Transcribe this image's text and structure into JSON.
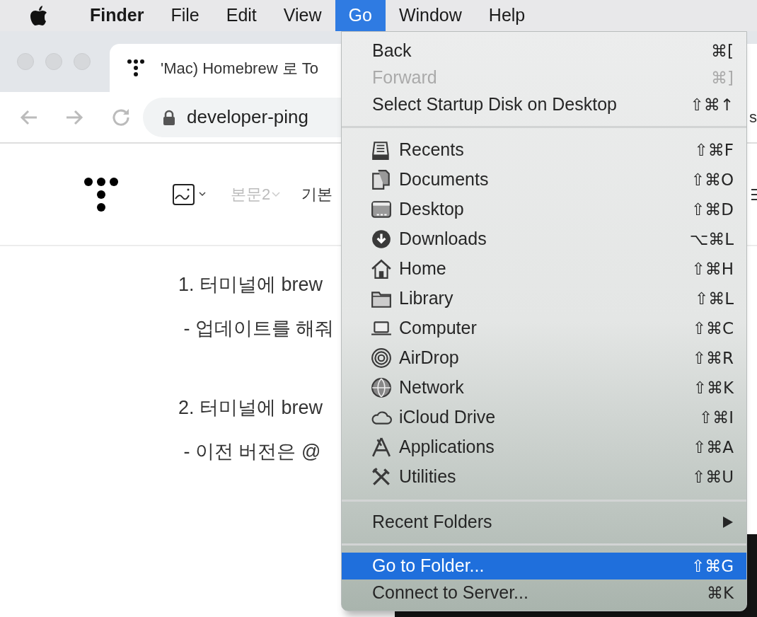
{
  "menu_bar": {
    "items": [
      {
        "label": "Finder",
        "kind": "app",
        "selected": false
      },
      {
        "label": "File",
        "kind": "menu",
        "selected": false
      },
      {
        "label": "Edit",
        "kind": "menu",
        "selected": false
      },
      {
        "label": "View",
        "kind": "menu",
        "selected": false
      },
      {
        "label": "Go",
        "kind": "menu",
        "selected": true
      },
      {
        "label": "Window",
        "kind": "menu",
        "selected": false
      },
      {
        "label": "Help",
        "kind": "menu",
        "selected": false
      }
    ]
  },
  "browser": {
    "tab_title": "'Mac) Homebrew 로 To",
    "address": "developer-ping",
    "address_tail": "s",
    "toolbar": {
      "style_label": "본문2",
      "font_label": "기본"
    },
    "content": [
      {
        "text": "1. 터미널에 brew",
        "kind": "step"
      },
      {
        "text": " - 업데이트를 해줘",
        "kind": "note"
      },
      {
        "text": "2. 터미널에 brew",
        "kind": "step"
      },
      {
        "text": " - 이전 버전은 @",
        "kind": "note"
      }
    ]
  },
  "go_menu": {
    "sections": [
      {
        "items": [
          {
            "label": "Back",
            "shortcut": "⌘[",
            "kind": "plain",
            "disabled": false,
            "selected": false
          },
          {
            "label": "Forward",
            "shortcut": "⌘]",
            "kind": "plain",
            "disabled": true,
            "selected": false
          },
          {
            "label": "Select Startup Disk on Desktop",
            "shortcut": "⇧⌘↑",
            "kind": "plain",
            "disabled": false,
            "selected": false
          }
        ]
      },
      {
        "items": [
          {
            "label": "Recents",
            "shortcut": "⇧⌘F",
            "kind": "place",
            "disabled": false,
            "selected": false
          },
          {
            "label": "Documents",
            "shortcut": "⇧⌘O",
            "kind": "place",
            "disabled": false,
            "selected": false
          },
          {
            "label": "Desktop",
            "shortcut": "⇧⌘D",
            "kind": "place",
            "disabled": false,
            "selected": false
          },
          {
            "label": "Downloads",
            "shortcut": "⌥⌘L",
            "kind": "place",
            "disabled": false,
            "selected": false
          },
          {
            "label": "Home",
            "shortcut": "⇧⌘H",
            "kind": "place",
            "disabled": false,
            "selected": false
          },
          {
            "label": "Library",
            "shortcut": "⇧⌘L",
            "kind": "place",
            "disabled": false,
            "selected": false
          },
          {
            "label": "Computer",
            "shortcut": "⇧⌘C",
            "kind": "place",
            "disabled": false,
            "selected": false
          },
          {
            "label": "AirDrop",
            "shortcut": "⇧⌘R",
            "kind": "place",
            "disabled": false,
            "selected": false
          },
          {
            "label": "Network",
            "shortcut": "⇧⌘K",
            "kind": "place",
            "disabled": false,
            "selected": false
          },
          {
            "label": "iCloud Drive",
            "shortcut": "⇧⌘I",
            "kind": "place",
            "disabled": false,
            "selected": false
          },
          {
            "label": "Applications",
            "shortcut": "⇧⌘A",
            "kind": "place",
            "disabled": false,
            "selected": false
          },
          {
            "label": "Utilities",
            "shortcut": "⇧⌘U",
            "kind": "place",
            "disabled": false,
            "selected": false
          }
        ]
      },
      {
        "items": [
          {
            "label": "Recent Folders",
            "kind": "submenu",
            "disabled": false,
            "selected": false
          }
        ]
      },
      {
        "items": [
          {
            "label": "Go to Folder...",
            "shortcut": "⇧⌘G",
            "kind": "plain",
            "disabled": false,
            "selected": true
          },
          {
            "label": "Connect to Server...",
            "shortcut": "⌘K",
            "kind": "plain",
            "disabled": false,
            "selected": false
          }
        ]
      }
    ]
  }
}
